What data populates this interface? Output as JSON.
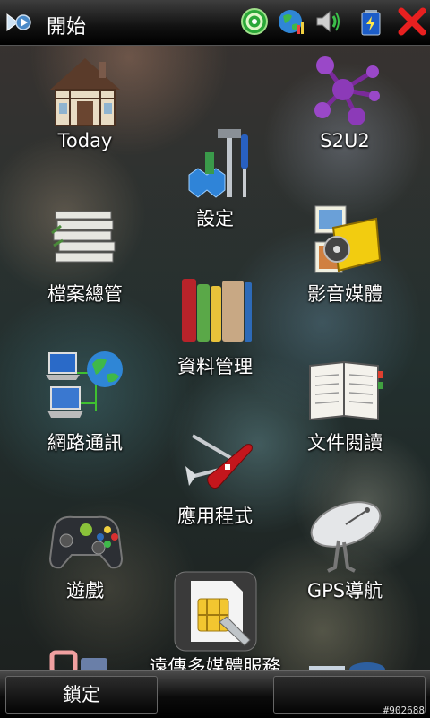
{
  "topbar": {
    "title": "開始",
    "tray_icons": [
      "connection-icon",
      "globe-network-icon",
      "volume-icon",
      "battery-icon",
      "close-icon"
    ]
  },
  "apps": [
    {
      "label": "Today",
      "icon": "house-icon"
    },
    {
      "label": "S2U2",
      "icon": "molecule-icon"
    },
    {
      "label": "設定",
      "icon": "tools-settings-icon"
    },
    {
      "label": "檔案總管",
      "icon": "papers-stack-icon"
    },
    {
      "label": "影音媒體",
      "icon": "media-film-icon"
    },
    {
      "label": "資料管理",
      "icon": "books-icon"
    },
    {
      "label": "網路通訊",
      "icon": "network-computers-icon"
    },
    {
      "label": "文件閱讀",
      "icon": "open-book-icon"
    },
    {
      "label": "應用程式",
      "icon": "swiss-knife-icon"
    },
    {
      "label": "遊戲",
      "icon": "gamepad-icon"
    },
    {
      "label": "GPS導航",
      "icon": "satellite-dish-icon"
    },
    {
      "label": "遠傳多媒體服務",
      "icon": "sim-card-icon"
    }
  ],
  "softkeys": {
    "left": "鎖定",
    "right": ""
  },
  "watermark": "#902688"
}
